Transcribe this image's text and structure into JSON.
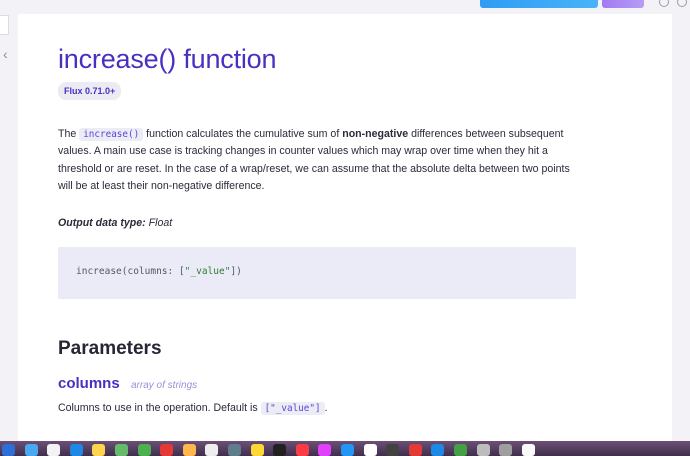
{
  "page": {
    "title": "increase() function",
    "version_badge": "Flux 0.71.0+",
    "collapse_icon": "chevron-left-icon"
  },
  "description": {
    "part1": "The ",
    "code": "increase()",
    "part2": " function calculates the cumulative sum of ",
    "bold": "non-negative",
    "part3": " differences between subsequent values. A main use case is tracking changes in counter values which may wrap over time when they hit a threshold or are reset. In the case of a wrap/reset, we can assume that the absolute delta between two points will be at least their non-negative difference."
  },
  "output_type": {
    "label": "Output data type:",
    "value": "Float"
  },
  "code_example": {
    "prefix": "increase(columns: [",
    "string": "\"_value\"",
    "suffix": "])"
  },
  "parameters": {
    "heading": "Parameters",
    "items": [
      {
        "name": "columns",
        "type": "array of strings",
        "desc_prefix": "Columns to use in the operation. Default is ",
        "default_code": "[\"_value\"]",
        "desc_suffix": "."
      }
    ]
  },
  "dock": {
    "icon_colors": [
      "#2c6fd6",
      "#4aa8f0",
      "#f3f3f3",
      "#1e88e5",
      "#ffd54f",
      "#66bb6a",
      "#4caf50",
      "#e53935",
      "#ffb74d",
      "#eeeeee",
      "#607d8b",
      "#fdd835",
      "#212121",
      "#fc3c44",
      "#e040fb",
      "#2196f3",
      "#ffffff",
      "#424242",
      "#e53935",
      "#1e88e5",
      "#43a047",
      "#bdbdbd",
      "#9e9e9e",
      "#fafafa"
    ]
  }
}
